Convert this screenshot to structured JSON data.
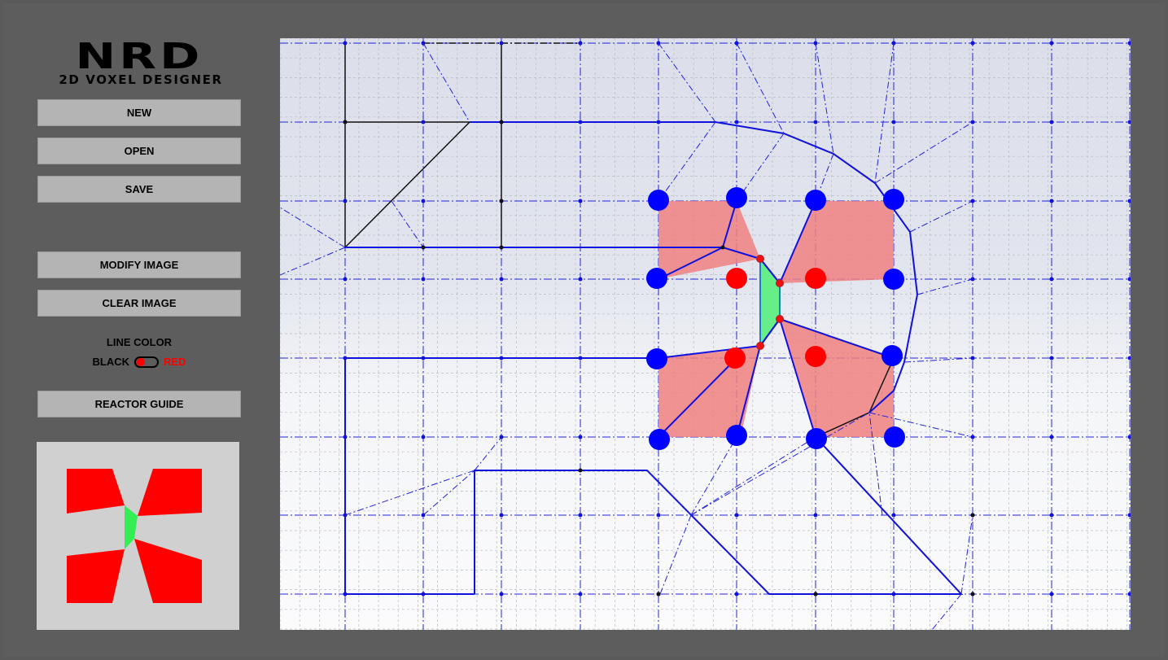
{
  "app": {
    "logo_title": "NRD",
    "logo_subtitle": "2D VOXEL DESIGNER"
  },
  "sidebar": {
    "new_label": "NEW",
    "open_label": "OPEN",
    "save_label": "SAVE",
    "modify_image_label": "MODIFY IMAGE",
    "clear_image_label": "CLEAR IMAGE",
    "line_color_title": "LINE COLOR",
    "line_color_black": "BLACK",
    "line_color_red": "RED",
    "reactor_guide_label": "REACTOR GUIDE"
  },
  "colors": {
    "background": "#5d5d5d",
    "button": "#b4b4b4",
    "grid_line": "#1010ee",
    "blue_node": "#0000ff",
    "red_node": "#ff0000",
    "red_region": "#f08080",
    "green_region": "#66ee88",
    "black_line": "#000000"
  },
  "line_color_toggle": {
    "state": "RED"
  },
  "icons": [
    "toggle-switch"
  ]
}
